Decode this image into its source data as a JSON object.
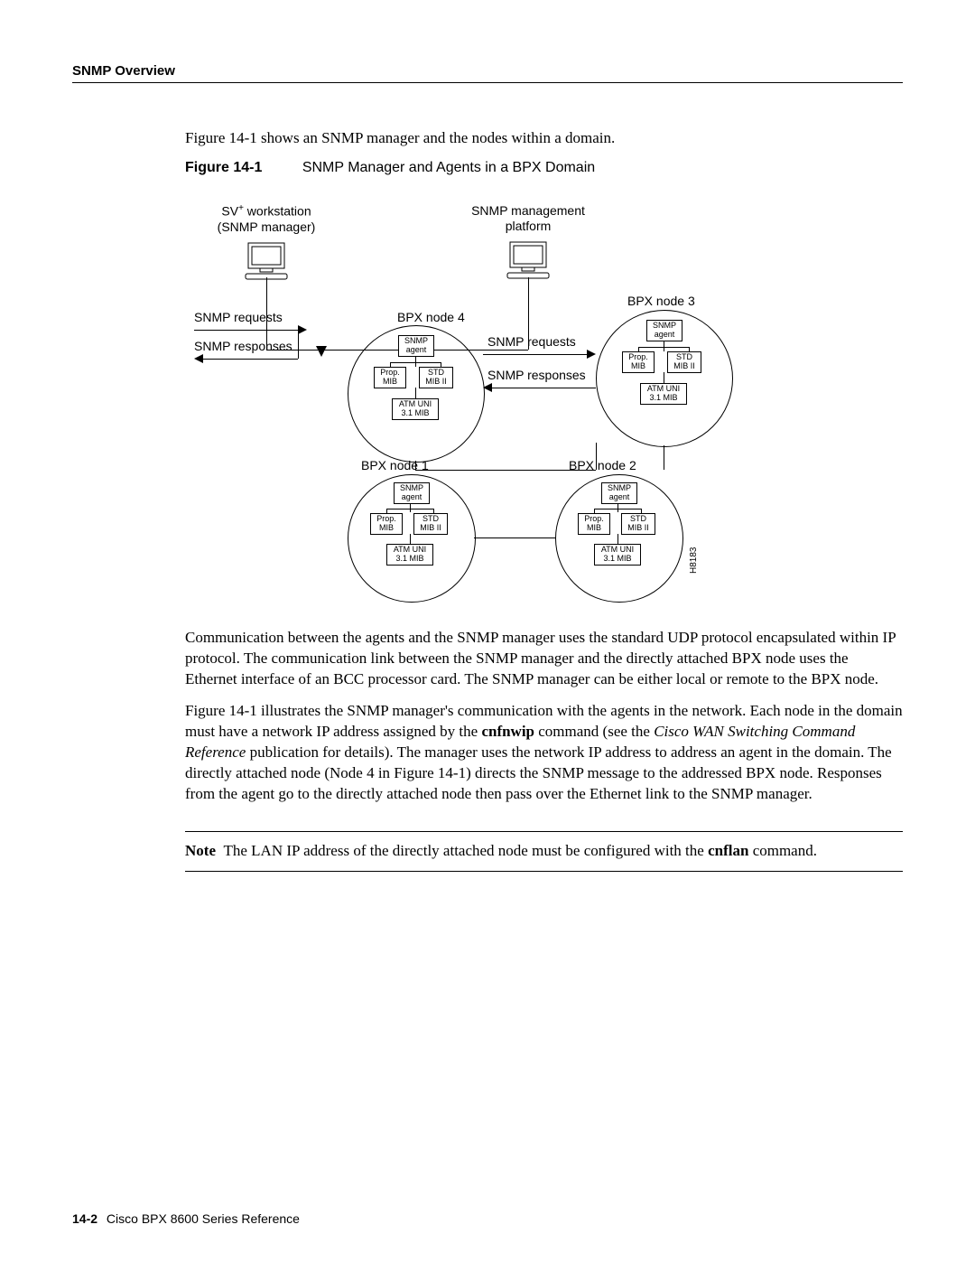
{
  "header": {
    "title": "SNMP Overview"
  },
  "intro": "Figure 14-1 shows an SNMP manager and the nodes within a domain.",
  "figure": {
    "label": "Figure 14-1",
    "title": "SNMP Manager and Agents in a BPX Domain",
    "workstation1_l1": "SV",
    "workstation1_sup": "+",
    "workstation1_l1b": " workstation",
    "workstation1_l2": "(SNMP manager)",
    "workstation2_l1": "SNMP management",
    "workstation2_l2": "platform",
    "req_label": "SNMP requests",
    "resp_label": "SNMP responses",
    "node1": "BPX node 1",
    "node2": "BPX node 2",
    "node3": "BPX node 3",
    "node4": "BPX node 4",
    "box_agent_l1": "SNMP",
    "box_agent_l2": "agent",
    "box_prop_l1": "Prop.",
    "box_prop_l2": "MIB",
    "box_std_l1": "STD",
    "box_std_l2": "MIB II",
    "box_atm_l1": "ATM UNI",
    "box_atm_l2": "3.1 MIB",
    "sideid": "H8183"
  },
  "paragraphs": {
    "p1": "Communication between the agents and the SNMP manager uses the standard UDP protocol encapsulated within IP protocol. The communication link between the SNMP manager and the directly attached BPX node uses the Ethernet interface of an BCC processor card. The SNMP manager can be either local or remote to the BPX node.",
    "p2a": "Figure 14-1 illustrates the SNMP manager's communication with the agents in the network. Each node in the domain must have a network IP address assigned by the ",
    "p2_cmd": "cnfnwip",
    "p2b": " command (see the ",
    "p2_em": "Cisco WAN Switching Command Reference",
    "p2c": " publication for details). The manager uses the network IP address to address an agent in the domain. The directly attached node (Node 4 in Figure 14-1) directs the SNMP message to the addressed BPX node. Responses from the agent go to the directly attached node then pass over the Ethernet link to the SNMP manager."
  },
  "note": {
    "label": "Note",
    "t1": "The LAN IP address of the directly attached node must be configured with the ",
    "cmd": "cnflan",
    "t2": " command."
  },
  "footer": {
    "pagenum": "14-2",
    "book": "Cisco BPX 8600 Series Reference"
  }
}
